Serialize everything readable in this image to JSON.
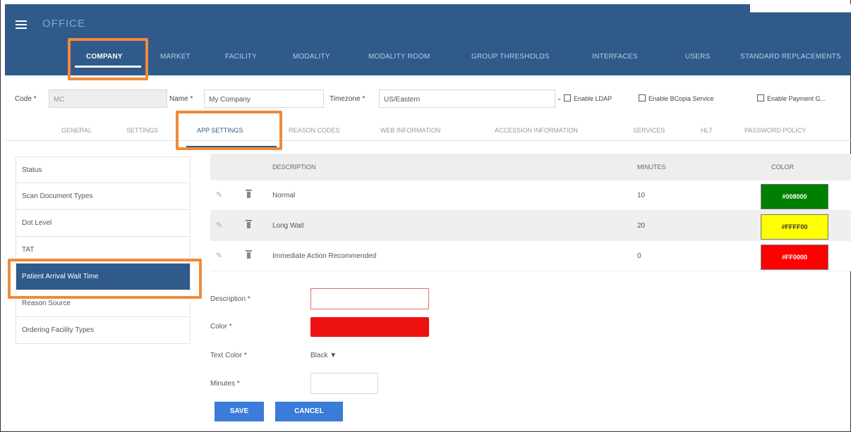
{
  "app": {
    "title": "OFFICE"
  },
  "nav": {
    "items": [
      {
        "label": "COMPANY",
        "active": true
      },
      {
        "label": "MARKET"
      },
      {
        "label": "FACILITY"
      },
      {
        "label": "MODALITY"
      },
      {
        "label": "MODALITY ROOM"
      },
      {
        "label": "GROUP THRESHOLDS"
      },
      {
        "label": "INTERFACES"
      },
      {
        "label": "USERS"
      },
      {
        "label": "STANDARD REPLACEMENTS"
      }
    ]
  },
  "company": {
    "code_label": "Code *",
    "code_value": "MC",
    "name_label": "Name *",
    "name_value": "My Company",
    "timezone_label": "Timezone *",
    "timezone_value": "US/Eastern",
    "checkboxes": [
      {
        "label": "Enable LDAP"
      },
      {
        "label": "Enable BCopia Service"
      },
      {
        "label": "Enable Payment G..."
      }
    ]
  },
  "subtabs": [
    {
      "label": "GENERAL"
    },
    {
      "label": "SETTINGS"
    },
    {
      "label": "APP SETTINGS",
      "active": true
    },
    {
      "label": "REASON CODES"
    },
    {
      "label": "WEB INFORMATION"
    },
    {
      "label": "ACCESSION INFORMATION"
    },
    {
      "label": "SERVICES"
    },
    {
      "label": "HL7"
    },
    {
      "label": "PASSWORD POLICY"
    }
  ],
  "sidebar": {
    "items": [
      {
        "label": "Status"
      },
      {
        "label": "Scan Document Types"
      },
      {
        "label": "Dot Level"
      },
      {
        "label": "TAT"
      },
      {
        "label": "Patient Arrival Wait Time",
        "active": true
      },
      {
        "label": "Reason Source"
      },
      {
        "label": "Ordering Facility Types"
      }
    ]
  },
  "table": {
    "headers": {
      "description": "DESCRIPTION",
      "minutes": "MINUTES",
      "color": "COLOR"
    },
    "rows": [
      {
        "description": "Normal",
        "minutes": "10",
        "color_label": "#008000",
        "bg": "#008000",
        "fg": "#ffffff"
      },
      {
        "description": "Long Wait",
        "minutes": "20",
        "color_label": "#FFFF00",
        "bg": "#ffff00",
        "fg": "#333333"
      },
      {
        "description": "Immediate Action Recommended",
        "minutes": "0",
        "color_label": "#FF0000",
        "bg": "#ff0000",
        "fg": "#ffffff"
      }
    ]
  },
  "form": {
    "description_label": "Description *",
    "color_label": "Color *",
    "text_color_label": "Text Color *",
    "text_color_value": "Black",
    "minutes_label": "Minutes *",
    "save_label": "SAVE",
    "cancel_label": "CANCEL",
    "color_value": "#ee1111"
  },
  "colors": {
    "header_bg": "#2f5a8a",
    "highlight": "#f08a3a",
    "button": "#3b7bd9"
  }
}
